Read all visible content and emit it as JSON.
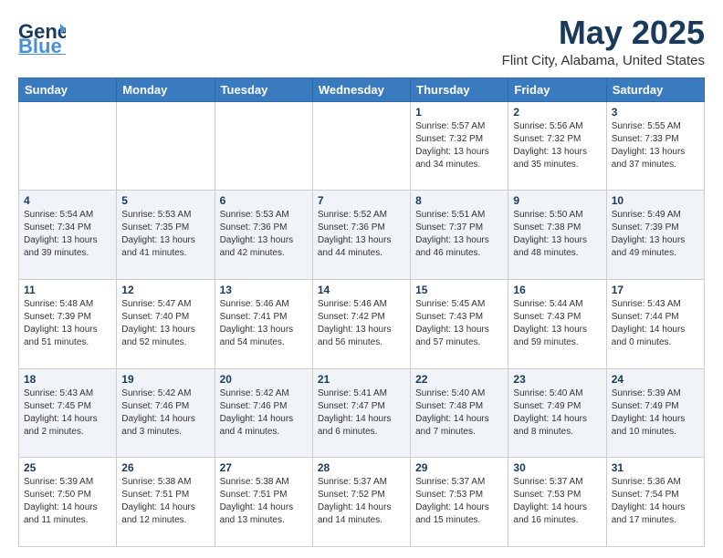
{
  "header": {
    "logo": {
      "general": "General",
      "blue": "Blue"
    },
    "title": "May 2025",
    "subtitle": "Flint City, Alabama, United States"
  },
  "days_of_week": [
    "Sunday",
    "Monday",
    "Tuesday",
    "Wednesday",
    "Thursday",
    "Friday",
    "Saturday"
  ],
  "weeks": [
    [
      {
        "day": "",
        "info": ""
      },
      {
        "day": "",
        "info": ""
      },
      {
        "day": "",
        "info": ""
      },
      {
        "day": "",
        "info": ""
      },
      {
        "day": "1",
        "info": "Sunrise: 5:57 AM\nSunset: 7:32 PM\nDaylight: 13 hours\nand 34 minutes."
      },
      {
        "day": "2",
        "info": "Sunrise: 5:56 AM\nSunset: 7:32 PM\nDaylight: 13 hours\nand 35 minutes."
      },
      {
        "day": "3",
        "info": "Sunrise: 5:55 AM\nSunset: 7:33 PM\nDaylight: 13 hours\nand 37 minutes."
      }
    ],
    [
      {
        "day": "4",
        "info": "Sunrise: 5:54 AM\nSunset: 7:34 PM\nDaylight: 13 hours\nand 39 minutes."
      },
      {
        "day": "5",
        "info": "Sunrise: 5:53 AM\nSunset: 7:35 PM\nDaylight: 13 hours\nand 41 minutes."
      },
      {
        "day": "6",
        "info": "Sunrise: 5:53 AM\nSunset: 7:36 PM\nDaylight: 13 hours\nand 42 minutes."
      },
      {
        "day": "7",
        "info": "Sunrise: 5:52 AM\nSunset: 7:36 PM\nDaylight: 13 hours\nand 44 minutes."
      },
      {
        "day": "8",
        "info": "Sunrise: 5:51 AM\nSunset: 7:37 PM\nDaylight: 13 hours\nand 46 minutes."
      },
      {
        "day": "9",
        "info": "Sunrise: 5:50 AM\nSunset: 7:38 PM\nDaylight: 13 hours\nand 48 minutes."
      },
      {
        "day": "10",
        "info": "Sunrise: 5:49 AM\nSunset: 7:39 PM\nDaylight: 13 hours\nand 49 minutes."
      }
    ],
    [
      {
        "day": "11",
        "info": "Sunrise: 5:48 AM\nSunset: 7:39 PM\nDaylight: 13 hours\nand 51 minutes."
      },
      {
        "day": "12",
        "info": "Sunrise: 5:47 AM\nSunset: 7:40 PM\nDaylight: 13 hours\nand 52 minutes."
      },
      {
        "day": "13",
        "info": "Sunrise: 5:46 AM\nSunset: 7:41 PM\nDaylight: 13 hours\nand 54 minutes."
      },
      {
        "day": "14",
        "info": "Sunrise: 5:46 AM\nSunset: 7:42 PM\nDaylight: 13 hours\nand 56 minutes."
      },
      {
        "day": "15",
        "info": "Sunrise: 5:45 AM\nSunset: 7:43 PM\nDaylight: 13 hours\nand 57 minutes."
      },
      {
        "day": "16",
        "info": "Sunrise: 5:44 AM\nSunset: 7:43 PM\nDaylight: 13 hours\nand 59 minutes."
      },
      {
        "day": "17",
        "info": "Sunrise: 5:43 AM\nSunset: 7:44 PM\nDaylight: 14 hours\nand 0 minutes."
      }
    ],
    [
      {
        "day": "18",
        "info": "Sunrise: 5:43 AM\nSunset: 7:45 PM\nDaylight: 14 hours\nand 2 minutes."
      },
      {
        "day": "19",
        "info": "Sunrise: 5:42 AM\nSunset: 7:46 PM\nDaylight: 14 hours\nand 3 minutes."
      },
      {
        "day": "20",
        "info": "Sunrise: 5:42 AM\nSunset: 7:46 PM\nDaylight: 14 hours\nand 4 minutes."
      },
      {
        "day": "21",
        "info": "Sunrise: 5:41 AM\nSunset: 7:47 PM\nDaylight: 14 hours\nand 6 minutes."
      },
      {
        "day": "22",
        "info": "Sunrise: 5:40 AM\nSunset: 7:48 PM\nDaylight: 14 hours\nand 7 minutes."
      },
      {
        "day": "23",
        "info": "Sunrise: 5:40 AM\nSunset: 7:49 PM\nDaylight: 14 hours\nand 8 minutes."
      },
      {
        "day": "24",
        "info": "Sunrise: 5:39 AM\nSunset: 7:49 PM\nDaylight: 14 hours\nand 10 minutes."
      }
    ],
    [
      {
        "day": "25",
        "info": "Sunrise: 5:39 AM\nSunset: 7:50 PM\nDaylight: 14 hours\nand 11 minutes."
      },
      {
        "day": "26",
        "info": "Sunrise: 5:38 AM\nSunset: 7:51 PM\nDaylight: 14 hours\nand 12 minutes."
      },
      {
        "day": "27",
        "info": "Sunrise: 5:38 AM\nSunset: 7:51 PM\nDaylight: 14 hours\nand 13 minutes."
      },
      {
        "day": "28",
        "info": "Sunrise: 5:37 AM\nSunset: 7:52 PM\nDaylight: 14 hours\nand 14 minutes."
      },
      {
        "day": "29",
        "info": "Sunrise: 5:37 AM\nSunset: 7:53 PM\nDaylight: 14 hours\nand 15 minutes."
      },
      {
        "day": "30",
        "info": "Sunrise: 5:37 AM\nSunset: 7:53 PM\nDaylight: 14 hours\nand 16 minutes."
      },
      {
        "day": "31",
        "info": "Sunrise: 5:36 AM\nSunset: 7:54 PM\nDaylight: 14 hours\nand 17 minutes."
      }
    ]
  ]
}
